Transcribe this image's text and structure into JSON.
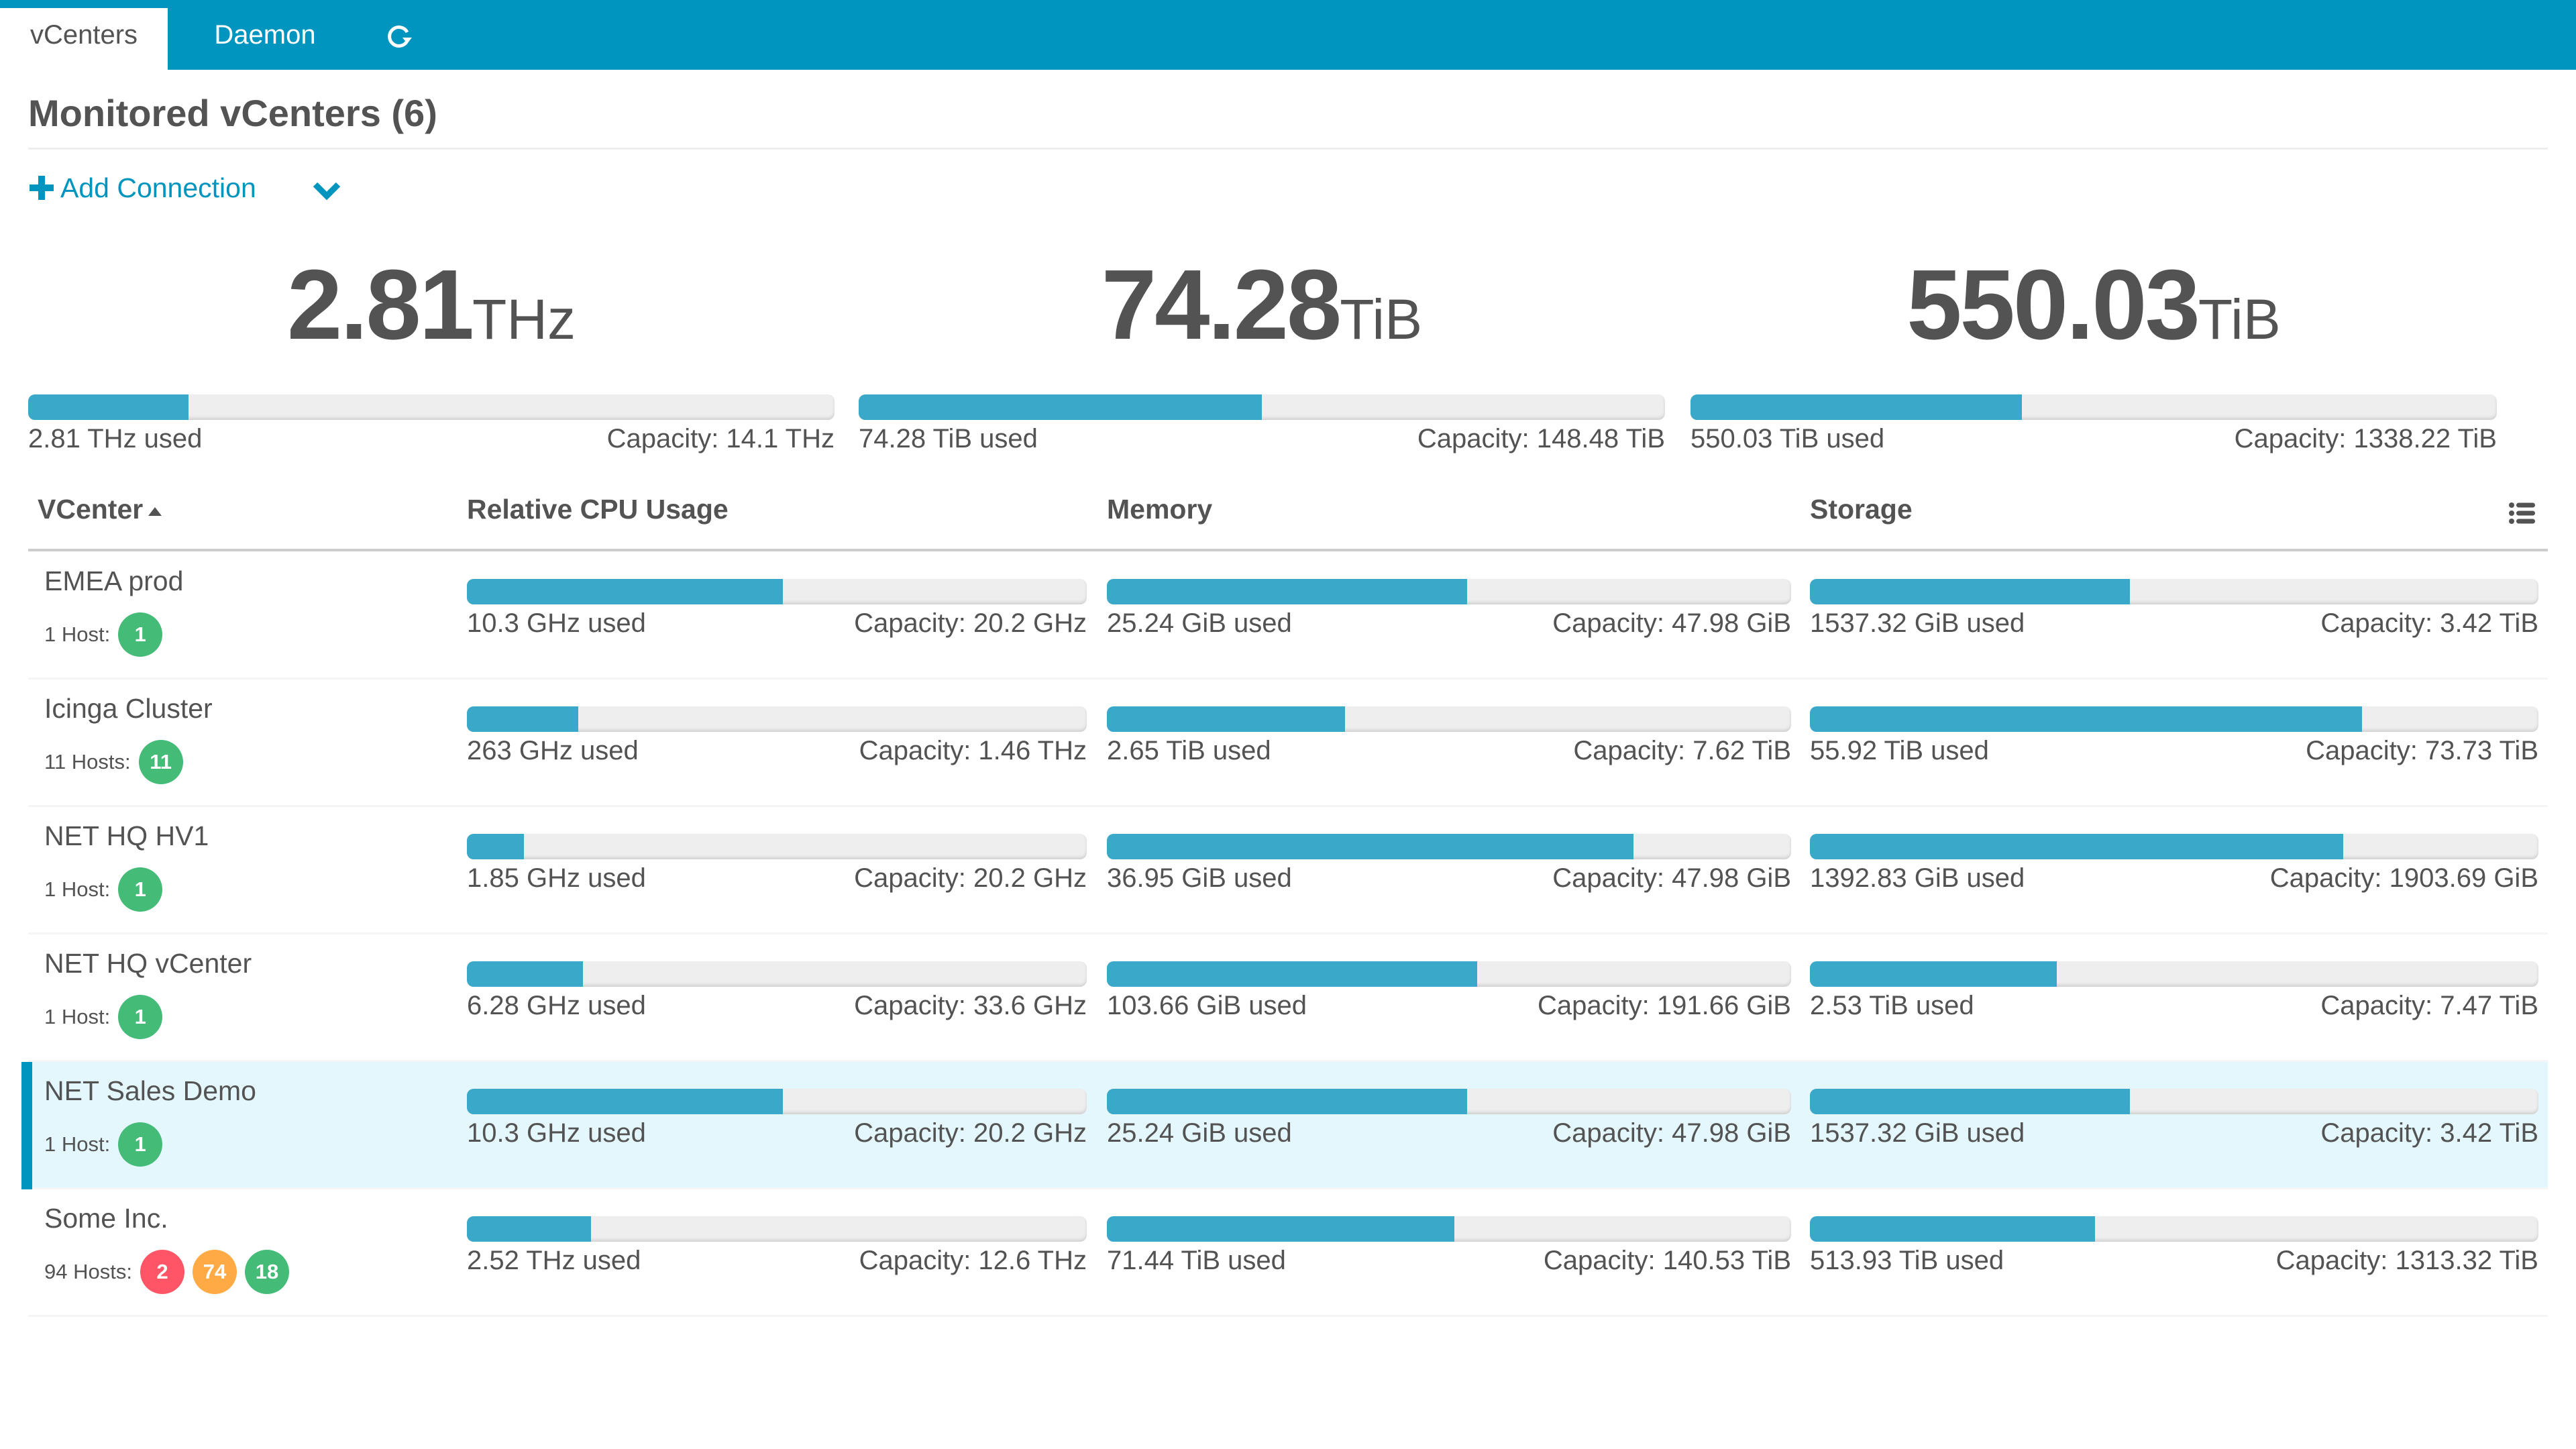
{
  "tabs": [
    {
      "label": "vCenters",
      "active": true
    },
    {
      "label": "Daemon",
      "active": false
    },
    {
      "icon": "refresh-icon"
    }
  ],
  "page_title": "Monitored vCenters (6)",
  "add_connection_label": "Add Connection",
  "colors": {
    "brand": "#0095bf",
    "bar_fill": "#3aa9c9",
    "bar_track": "#eeeeee",
    "ok": "#44bb77",
    "warning": "#ffaa44",
    "critical": "#ff5566",
    "selected_row": "#e4f7fd"
  },
  "summary": [
    {
      "value": "2.81",
      "unit": "THz",
      "used_label": "2.81 THz used",
      "capacity_label": "Capacity: 14.1 THz",
      "fraction": 0.199
    },
    {
      "value": "74.28",
      "unit": "TiB",
      "used_label": "74.28 TiB used",
      "capacity_label": "Capacity: 148.48 TiB",
      "fraction": 0.5
    },
    {
      "value": "550.03",
      "unit": "TiB",
      "used_label": "550.03 TiB used",
      "capacity_label": "Capacity: 1338.22 TiB",
      "fraction": 0.411
    }
  ],
  "table": {
    "columns": [
      "VCenter",
      "Relative CPU Usage",
      "Memory",
      "Storage"
    ],
    "sort_column": "VCenter",
    "sort_direction": "asc",
    "rows": [
      {
        "name": "EMEA prod",
        "hosts_label": "1 Host:",
        "selected": false,
        "badges": [
          {
            "state": "ok",
            "count": "1"
          }
        ],
        "cpu": {
          "used": "10.3 GHz used",
          "capacity": "Capacity: 20.2 GHz",
          "fraction": 0.51
        },
        "memory": {
          "used": "25.24 GiB used",
          "capacity": "Capacity: 47.98 GiB",
          "fraction": 0.526
        },
        "storage": {
          "used": "1537.32 GiB used",
          "capacity": "Capacity: 3.42 TiB",
          "fraction": 0.439
        }
      },
      {
        "name": "Icinga Cluster",
        "hosts_label": "11 Hosts:",
        "selected": false,
        "badges": [
          {
            "state": "ok",
            "count": "11"
          }
        ],
        "cpu": {
          "used": "263 GHz used",
          "capacity": "Capacity: 1.46 THz",
          "fraction": 0.18
        },
        "memory": {
          "used": "2.65 TiB used",
          "capacity": "Capacity: 7.62 TiB",
          "fraction": 0.348
        },
        "storage": {
          "used": "55.92 TiB used",
          "capacity": "Capacity: 73.73 TiB",
          "fraction": 0.758
        }
      },
      {
        "name": "NET HQ HV1",
        "hosts_label": "1 Host:",
        "selected": false,
        "badges": [
          {
            "state": "ok",
            "count": "1"
          }
        ],
        "cpu": {
          "used": "1.85 GHz used",
          "capacity": "Capacity: 20.2 GHz",
          "fraction": 0.092
        },
        "memory": {
          "used": "36.95 GiB used",
          "capacity": "Capacity: 47.98 GiB",
          "fraction": 0.77
        },
        "storage": {
          "used": "1392.83 GiB used",
          "capacity": "Capacity: 1903.69 GiB",
          "fraction": 0.732
        }
      },
      {
        "name": "NET HQ vCenter",
        "hosts_label": "1 Host:",
        "selected": false,
        "badges": [
          {
            "state": "ok",
            "count": "1"
          }
        ],
        "cpu": {
          "used": "6.28 GHz used",
          "capacity": "Capacity: 33.6 GHz",
          "fraction": 0.187
        },
        "memory": {
          "used": "103.66 GiB used",
          "capacity": "Capacity: 191.66 GiB",
          "fraction": 0.541
        },
        "storage": {
          "used": "2.53 TiB used",
          "capacity": "Capacity: 7.47 TiB",
          "fraction": 0.339
        }
      },
      {
        "name": "NET Sales Demo",
        "hosts_label": "1 Host:",
        "selected": true,
        "badges": [
          {
            "state": "ok",
            "count": "1"
          }
        ],
        "cpu": {
          "used": "10.3 GHz used",
          "capacity": "Capacity: 20.2 GHz",
          "fraction": 0.51
        },
        "memory": {
          "used": "25.24 GiB used",
          "capacity": "Capacity: 47.98 GiB",
          "fraction": 0.526
        },
        "storage": {
          "used": "1537.32 GiB used",
          "capacity": "Capacity: 3.42 TiB",
          "fraction": 0.439
        }
      },
      {
        "name": "Some Inc.",
        "hosts_label": "94 Hosts:",
        "selected": false,
        "badges": [
          {
            "state": "critical",
            "count": "2"
          },
          {
            "state": "warning",
            "count": "74"
          },
          {
            "state": "ok",
            "count": "18"
          }
        ],
        "cpu": {
          "used": "2.52 THz used",
          "capacity": "Capacity: 12.6 THz",
          "fraction": 0.2
        },
        "memory": {
          "used": "71.44 TiB used",
          "capacity": "Capacity: 140.53 TiB",
          "fraction": 0.508
        },
        "storage": {
          "used": "513.93 TiB used",
          "capacity": "Capacity: 1313.32 TiB",
          "fraction": 0.391
        }
      }
    ]
  }
}
